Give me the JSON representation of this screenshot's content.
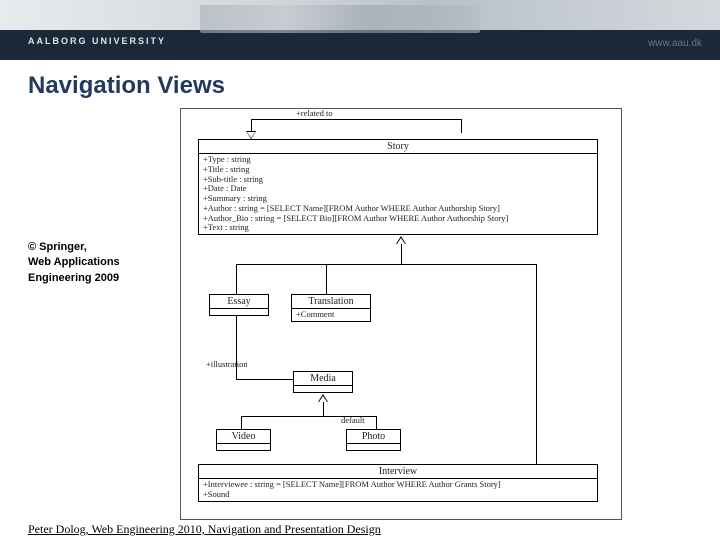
{
  "banner": {
    "logo": "AALBORG UNIVERSITY",
    "url": "www.aau.dk"
  },
  "title": "Navigation Views",
  "citation": {
    "line1": "© Springer,",
    "line2": "Web Applications",
    "line3": "Engineering 2009"
  },
  "diagram": {
    "related_label": "+related to",
    "story": {
      "name": "Story",
      "attrs": [
        "+Type : string",
        "+Title : string",
        "+Sub-title : string",
        "+Date : Date",
        "+Summary : string",
        "+Author : string = [SELECT Name][FROM Author WHERE Author Authorship Story]",
        "+Author_Bio : string = [SELECT Bio][FROM Author WHERE Author Authorship Story]",
        "+Text : string"
      ]
    },
    "essay": {
      "name": "Essay"
    },
    "translation": {
      "name": "Translation",
      "attr": "+Comment"
    },
    "media": {
      "name": "Media"
    },
    "video": {
      "name": "Video"
    },
    "photo": {
      "name": "Photo"
    },
    "interview": {
      "name": "Interview",
      "attrs": [
        "+Interviewee : string = [SELECT Name][FROM Author WHERE Author Grants Story]",
        "+Sound"
      ]
    },
    "illustration_label": "+illustration",
    "default_label": "default"
  },
  "footer": "Peter Dolog, Web Engineering 2010, Navigation and Presentation Design"
}
